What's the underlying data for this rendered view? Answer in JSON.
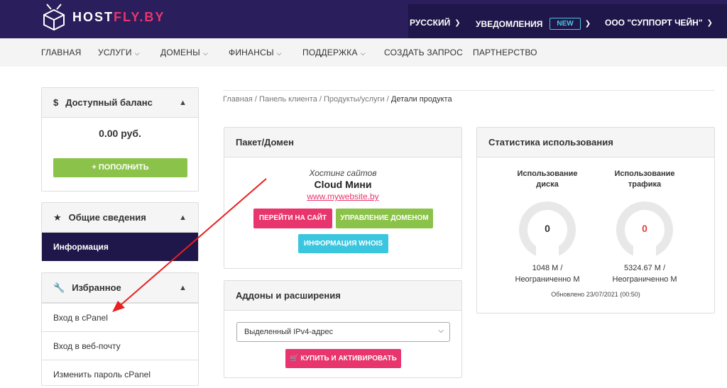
{
  "header": {
    "logo_text_1": "HOST",
    "logo_text_2": "FLY.BY",
    "language": "РУССКИЙ",
    "notifications": "УВЕДОМЛЕНИЯ",
    "new_badge": "NEW",
    "account": "ООО \"СУППОРТ ЧЕЙН\""
  },
  "menu": {
    "items": [
      "ГЛАВНАЯ",
      "УСЛУГИ",
      "ДОМЕНЫ",
      "ФИНАНСЫ",
      "ПОДДЕРЖКА",
      "СОЗДАТЬ ЗАПРОС",
      "ПАРТНЕРСТВО"
    ]
  },
  "sidebar": {
    "balance": {
      "title": "Доступный баланс",
      "amount": "0.00 руб.",
      "topup_button": "ПОПОЛНИТЬ"
    },
    "general": {
      "title": "Общие сведения",
      "item": "Информация"
    },
    "favorites": {
      "title": "Избранное",
      "items": [
        "Вход в cPanel",
        "Вход в веб-почту",
        "Изменить пароль cPanel"
      ]
    }
  },
  "breadcrumb": {
    "items": [
      "Главная",
      "Панель клиента",
      "Продукты/услуги"
    ],
    "current": "Детали продукта"
  },
  "package": {
    "title": "Пакет/Домен",
    "type": "Хостинг сайтов",
    "plan": "Cloud Мини",
    "domain": "www.mywebsite.by",
    "btn_visit": "ПЕРЕЙТИ НА САЙТ",
    "btn_domain": "УПРАВЛЕНИЕ ДОМЕНОМ",
    "btn_whois": "ИНФОРМАЦИЯ WHOIS"
  },
  "addons": {
    "title": "Аддоны и расширения",
    "select_value": "Выделенный IPv4-адрес",
    "buy_button": "КУПИТЬ И АКТИВИРОВАТЬ"
  },
  "usage": {
    "title": "Статистика использования",
    "disk_label_1": "Использование",
    "disk_label_2": "диска",
    "disk_value": "0",
    "disk_used": "1048 M /",
    "disk_limit": "Неограниченно M",
    "traffic_label_1": "Использование",
    "traffic_label_2": "трафика",
    "traffic_value": "0",
    "traffic_used": "5324.67 M /",
    "traffic_limit": "Неограниченно M",
    "updated": "Обновлено 23/07/2021 (00:50)"
  },
  "colors": {
    "header_bg": "#2a1f5c",
    "pink": "#e8356d",
    "green": "#8bc34a",
    "cyan": "#3bc6e0",
    "red_arrow": "#e82020"
  }
}
